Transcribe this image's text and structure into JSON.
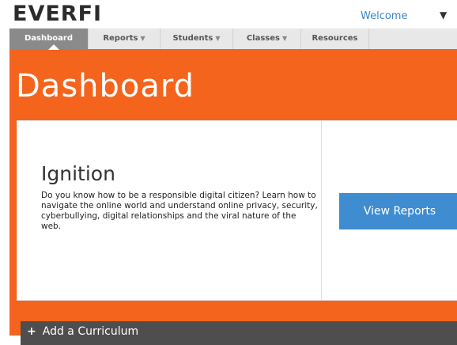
{
  "header": {
    "logo": "EVERFI",
    "welcome": "Welcome",
    "caret": "▼"
  },
  "nav": {
    "items": [
      {
        "label": "Dashboard",
        "caret": ""
      },
      {
        "label": "Reports",
        "caret": "▼"
      },
      {
        "label": "Students",
        "caret": "▼"
      },
      {
        "label": "Classes",
        "caret": "▼"
      },
      {
        "label": "Resources",
        "caret": ""
      }
    ]
  },
  "main": {
    "title": "Dashboard",
    "card": {
      "title": "Ignition",
      "description": "Do you know how to be a responsible digital citizen? Learn how to navigate the online world and understand online privacy, security, cyberbullying, digital relationships and the viral nature of the web.",
      "button": "View Reports"
    },
    "add_curriculum": {
      "plus": "+",
      "label": "Add a Curriculum"
    }
  },
  "colors": {
    "accent": "#f4641c",
    "button": "#3f8cd0",
    "nav_active": "#8a8a8a"
  }
}
